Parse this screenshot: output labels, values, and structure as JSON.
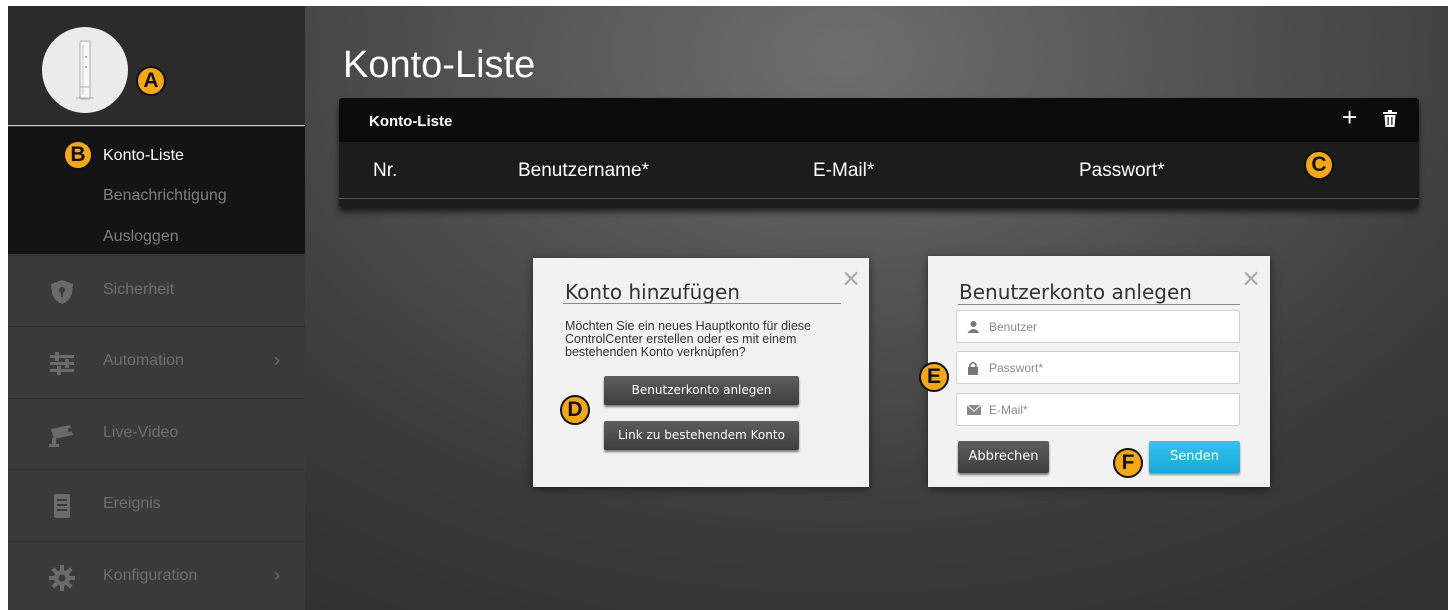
{
  "sidebar": {
    "submenu": [
      {
        "label": "Konto-Liste",
        "active": true
      },
      {
        "label": "Benachrichtigung",
        "active": false
      },
      {
        "label": "Ausloggen",
        "active": false
      }
    ],
    "nav": [
      {
        "label": "Sicherheit",
        "icon": "shield-icon",
        "chevron": false
      },
      {
        "label": "Automation",
        "icon": "sliders-icon",
        "chevron": true
      },
      {
        "label": "Live-Video",
        "icon": "camera-icon",
        "chevron": false
      },
      {
        "label": "Ereignis",
        "icon": "list-icon",
        "chevron": false
      },
      {
        "label": "Konfiguration",
        "icon": "gear-icon",
        "chevron": true
      }
    ],
    "chevron_glyph": "›"
  },
  "badges": {
    "a": "A",
    "b": "B",
    "c": "C",
    "d": "D",
    "e": "E",
    "f": "F"
  },
  "main": {
    "page_title": "Konto-Liste",
    "panel": {
      "title": "Konto-Liste",
      "add_glyph": "+",
      "columns": [
        "Nr.",
        "Benutzername*",
        "E-Mail*",
        "Passwort*"
      ]
    }
  },
  "dialog_add": {
    "title": "Konto hinzufügen",
    "close_glyph": "×",
    "message_lines": [
      "Möchten Sie ein neues Hauptkonto für diese",
      "ControlCenter erstellen oder es mit einem",
      "bestehenden Konto verknüpfen?"
    ],
    "create_button": "Benutzerkonto anlegen",
    "link_button": "Link zu bestehendem Konto"
  },
  "dialog_create": {
    "title": "Benutzerkonto anlegen",
    "close_glyph": "×",
    "user_placeholder": "Benutzer",
    "password_placeholder": "Passwort*",
    "email_placeholder": "E-Mail*",
    "cancel_button": "Abbrechen",
    "send_button": "Senden"
  },
  "colors": {
    "accent_cyan": "#1fb5e0",
    "badge_orange": "#f5a71a",
    "sidebar_bg": "#3a3a3a"
  }
}
